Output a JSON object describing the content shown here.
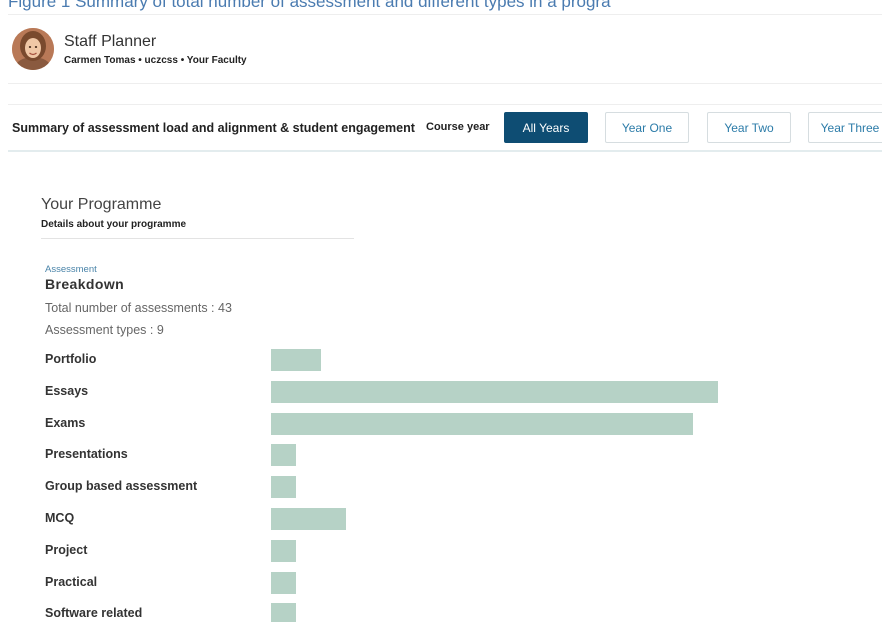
{
  "caption": "Figure 1 Summary of total number of assessment and different types in a progra",
  "header": {
    "app_title": "Staff Planner",
    "user_line": "Carmen Tomas • uczcss • Your Faculty"
  },
  "toolbar": {
    "summary_title": "Summary of assessment load and alignment & student engagement",
    "course_year_label": "Course year",
    "years": [
      {
        "label": "All Years",
        "active": true
      },
      {
        "label": "Year One",
        "active": false
      },
      {
        "label": "Year Two",
        "active": false
      },
      {
        "label": "Year Three",
        "active": false
      }
    ]
  },
  "programme": {
    "title": "Your Programme",
    "subtitle": "Details about your programme"
  },
  "assessment": {
    "kicker": "Assessment",
    "title": "Breakdown",
    "total_label": "Total number of assessments : 43",
    "types_label": "Assessment types : 9"
  },
  "chart_data": {
    "type": "bar",
    "orientation": "horizontal",
    "categories": [
      "Portfolio",
      "Essays",
      "Exams",
      "Presentations",
      "Group based assessment",
      "MCQ",
      "Project",
      "Practical",
      "Software related"
    ],
    "values": [
      2,
      18,
      17,
      1,
      1,
      3,
      1,
      1,
      1
    ],
    "bar_color": "#b6d2c6"
  },
  "colors": {
    "accent": "#0e4d73",
    "link": "#2b7ba8",
    "bar": "#b6d2c6"
  }
}
